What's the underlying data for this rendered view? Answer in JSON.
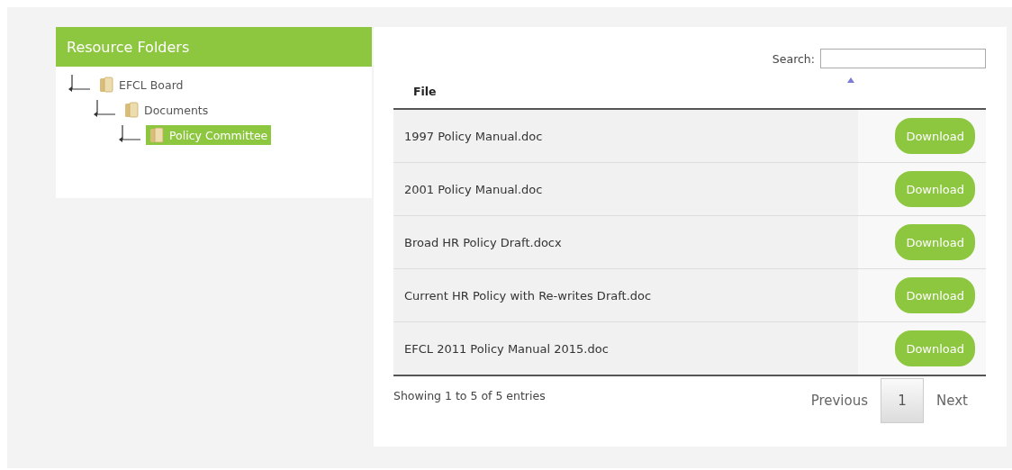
{
  "sidebar": {
    "title": "Resource Folders",
    "tree": [
      {
        "label": "EFCL Board",
        "selected": false,
        "children": [
          {
            "label": "Documents",
            "selected": false,
            "children": [
              {
                "label": "Policy Committee",
                "selected": true
              }
            ]
          }
        ]
      }
    ]
  },
  "search": {
    "label": "Search:"
  },
  "table": {
    "columns": [
      {
        "label": "File",
        "sorted": true
      }
    ],
    "rows": [
      {
        "file": "1997 Policy Manual.doc",
        "action": "Download"
      },
      {
        "file": "2001 Policy Manual.doc",
        "action": "Download"
      },
      {
        "file": "Broad HR Policy Draft.docx",
        "action": "Download"
      },
      {
        "file": "Current HR Policy with Re-writes Draft.doc",
        "action": "Download"
      },
      {
        "file": "EFCL 2011 Policy Manual 2015.doc",
        "action": "Download"
      }
    ]
  },
  "info": "Showing 1 to 5 of 5 entries",
  "pagination": {
    "previous": "Previous",
    "pages": [
      {
        "label": "1",
        "selected": true
      }
    ],
    "next": "Next"
  }
}
